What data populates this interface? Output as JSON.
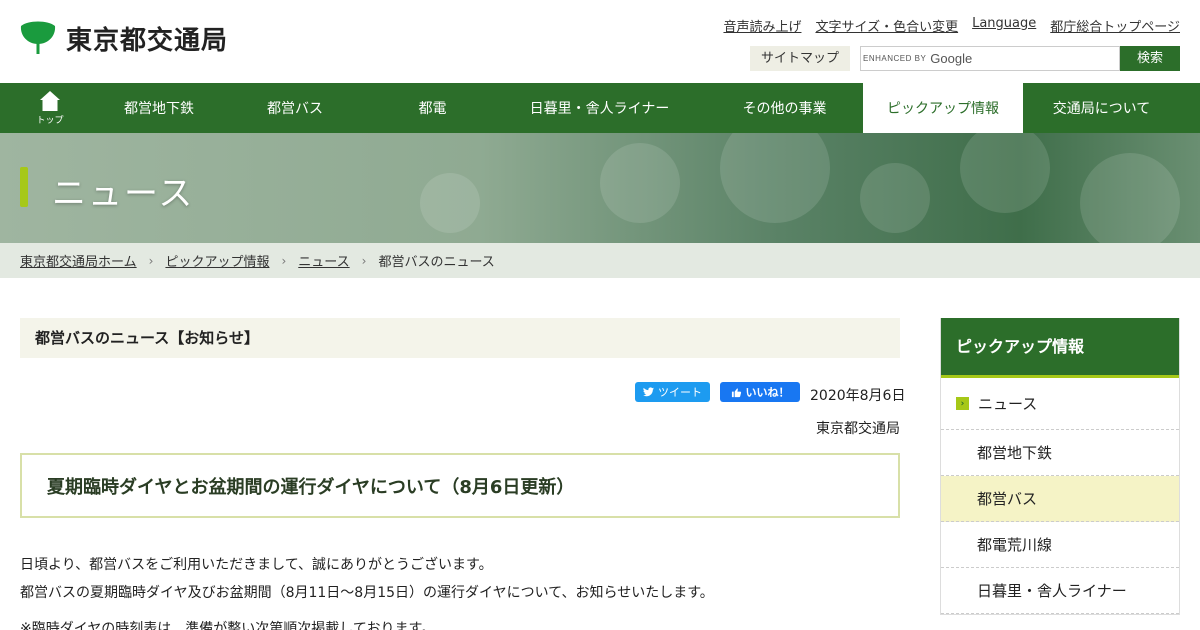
{
  "header": {
    "logo_text": "東京都交通局",
    "brand_color": "#1a9b3e",
    "util_links": [
      "音声読み上げ",
      "文字サイズ・色合い変更",
      "Language",
      "都庁総合トップページ"
    ],
    "sitemap_label": "サイトマップ",
    "search_placeholder_prefix": "ENHANCED BY",
    "search_placeholder_brand": "Google",
    "search_button": "検索"
  },
  "nav": {
    "home_label": "トップ",
    "items": [
      {
        "label": "都営地下鉄",
        "active": false
      },
      {
        "label": "都営バス",
        "active": false
      },
      {
        "label": "都電",
        "active": false
      },
      {
        "label": "日暮里・舎人ライナー",
        "active": false
      },
      {
        "label": "その他の事業",
        "active": false
      },
      {
        "label": "ピックアップ情報",
        "active": true
      },
      {
        "label": "交通局について",
        "active": false
      }
    ]
  },
  "hero": {
    "title": "ニュース"
  },
  "breadcrumb": {
    "items": [
      "東京都交通局ホーム",
      "ピックアップ情報",
      "ニュース"
    ],
    "current": "都営バスのニュース"
  },
  "main": {
    "section_title": "都営バスのニュース【お知らせ】",
    "tweet_label": "ツイート",
    "like_label": "いいね！",
    "date": "2020年8月6日",
    "author": "東京都交通局",
    "article_title": "夏期臨時ダイヤとお盆期間の運行ダイヤについて（8月6日更新）",
    "paragraphs": [
      "日頃より、都営バスをご利用いただきまして、誠にありがとうございます。",
      "都営バスの夏期臨時ダイヤ及びお盆期間（8月11日～8月15日）の運行ダイヤについて、お知らせいたします。",
      "※臨時ダイヤの時刻表は、準備が整い次第順次掲載しております。"
    ]
  },
  "sidebar": {
    "title": "ピックアップ情報",
    "items": [
      {
        "label": "ニュース",
        "active": false
      },
      {
        "label": "都営地下鉄",
        "active": false
      },
      {
        "label": "都営バス",
        "active": true
      },
      {
        "label": "都電荒川線",
        "active": false
      },
      {
        "label": "日暮里・舎人ライナー",
        "active": false
      }
    ]
  }
}
